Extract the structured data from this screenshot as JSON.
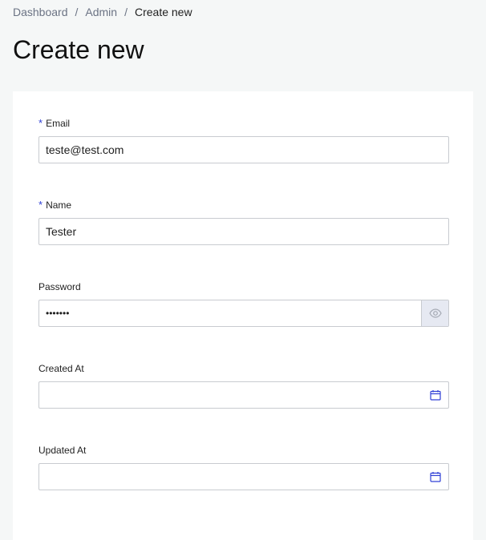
{
  "breadcrumb": {
    "items": [
      "Dashboard",
      "Admin"
    ],
    "separator": "/",
    "current": "Create new"
  },
  "page": {
    "title": "Create new"
  },
  "form": {
    "email": {
      "label": "Email",
      "required_mark": "*",
      "value": "teste@test.com"
    },
    "name": {
      "label": "Name",
      "required_mark": "*",
      "value": "Tester"
    },
    "password": {
      "label": "Password",
      "value": "•••••••",
      "toggle_icon": "eye-icon"
    },
    "created_at": {
      "label": "Created At",
      "value": "",
      "icon": "calendar-icon"
    },
    "updated_at": {
      "label": "Updated At",
      "value": "",
      "icon": "calendar-icon"
    }
  },
  "colors": {
    "accent": "#3040d6",
    "background": "#f5f7f7",
    "card": "#ffffff",
    "border": "#c8cbd0",
    "muted_text": "#6b7384"
  }
}
